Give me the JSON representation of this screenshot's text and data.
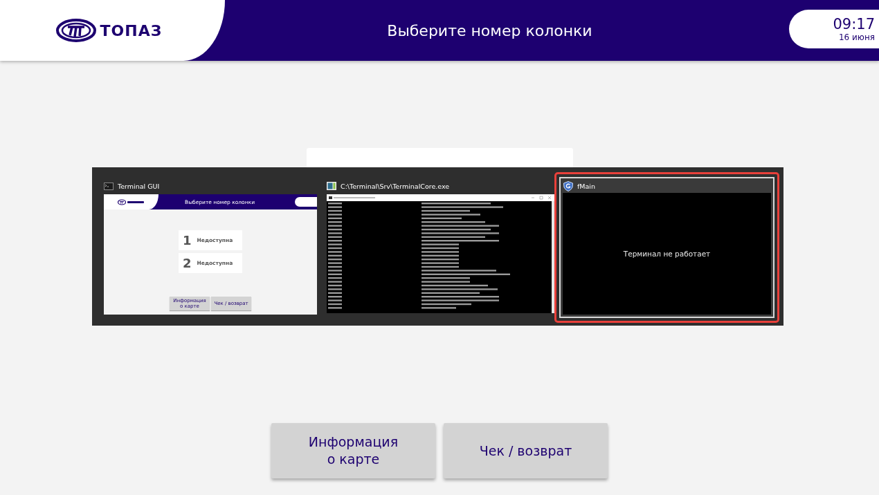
{
  "app": {
    "logo": "ТОПАЗ",
    "title": "Выберите номер колонки",
    "time": "09:17",
    "date": "16 июня",
    "actions": [
      {
        "lines": [
          "Информация",
          "о карте"
        ]
      },
      {
        "lines": [
          "Чек / возврат"
        ]
      }
    ]
  },
  "switcher": {
    "windows": [
      {
        "kind": "gui",
        "title": "Terminal GUI",
        "selected": false,
        "app": {
          "title": "Выберите номер колонки",
          "columns": [
            {
              "number": "1",
              "status": "Недоступна"
            },
            {
              "number": "2",
              "status": "Недоступна"
            }
          ],
          "actions": [
            {
              "lines": [
                "Информация",
                "о карте"
              ]
            },
            {
              "lines": [
                "Чек / возврат"
              ]
            }
          ]
        }
      },
      {
        "kind": "console",
        "title": "C:\\Terminal\\Srv\\TerminalCore.exe",
        "selected": false
      },
      {
        "kind": "form",
        "title": "fMain",
        "selected": true,
        "message": "Терминал не работает"
      }
    ]
  }
}
